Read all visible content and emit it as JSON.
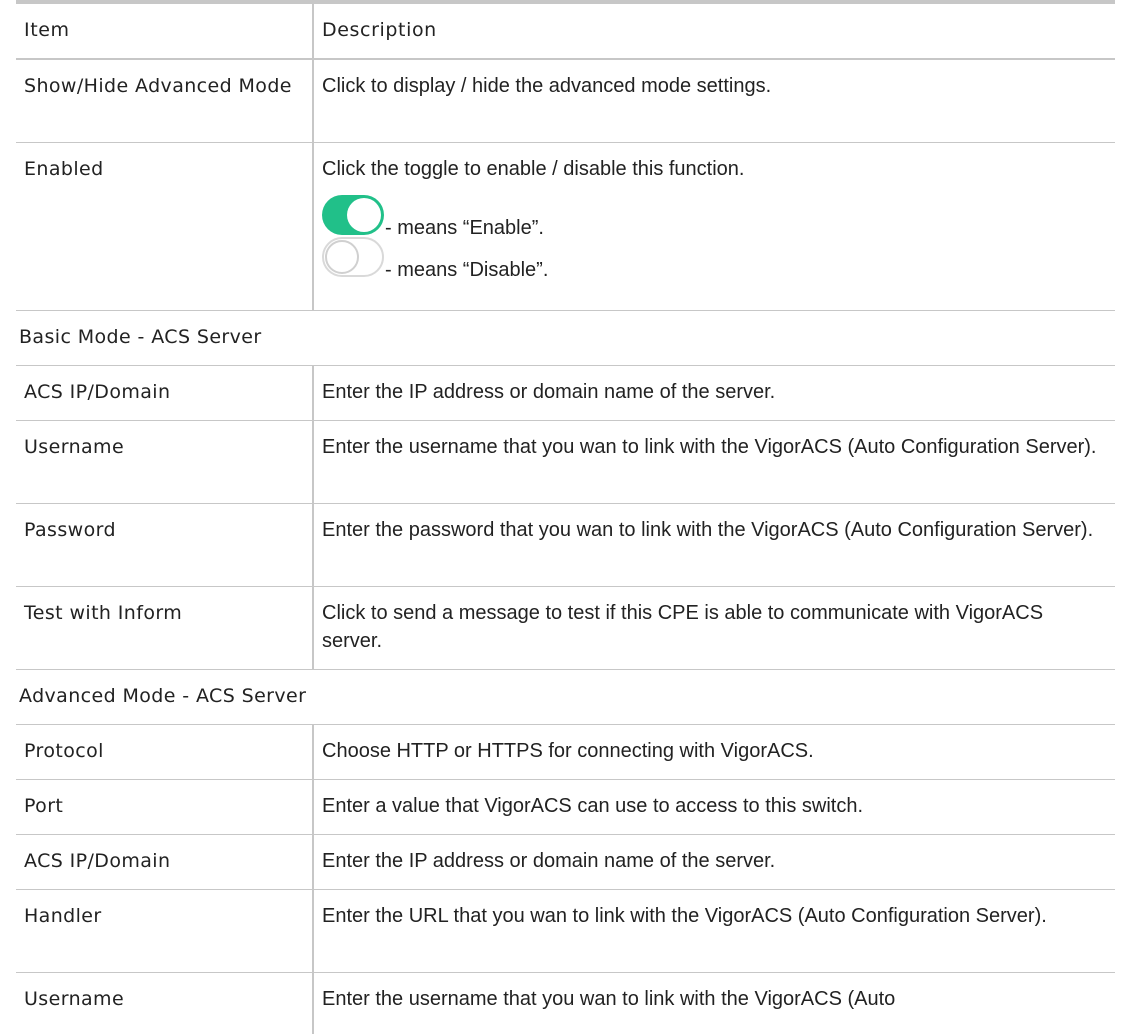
{
  "header": {
    "item": "Item",
    "description": "Description"
  },
  "rows_top": [
    {
      "item": "Show/Hide Advanced Mode",
      "description": "Click to display / hide the advanced mode settings."
    }
  ],
  "enabled": {
    "item": "Enabled",
    "description": "Click the toggle to enable / disable this function.",
    "on_text": "- means “Enable”.",
    "off_text": "- means “Disable”.",
    "on_color": "#21c089"
  },
  "sections": [
    {
      "title": "Basic Mode - ACS Server",
      "rows": [
        {
          "item": "ACS IP/Domain",
          "description": "Enter the IP address or domain name of the server."
        },
        {
          "item": "Username",
          "description": "Enter the username that you wan to link with the VigorACS (Auto Configuration Server)."
        },
        {
          "item": "Password",
          "description": "Enter the password that you wan to link with the VigorACS (Auto Configuration Server)."
        },
        {
          "item": "Test with Inform",
          "description": "Click to send a message to test if this CPE is able to communicate with VigorACS server."
        }
      ]
    },
    {
      "title": "Advanced Mode - ACS Server",
      "rows": [
        {
          "item": "Protocol",
          "description": "Choose HTTP or HTTPS for connecting with VigorACS."
        },
        {
          "item": "Port",
          "description": "Enter a value that VigorACS can use to access to this switch."
        },
        {
          "item": "ACS IP/Domain",
          "description": "Enter the IP address or domain name of the server."
        },
        {
          "item": "Handler",
          "description": "Enter the URL that you wan to link with the VigorACS (Auto Configuration Server)."
        },
        {
          "item": "Username",
          "description": "Enter the username that you wan to link with the VigorACS (Auto"
        }
      ]
    }
  ]
}
